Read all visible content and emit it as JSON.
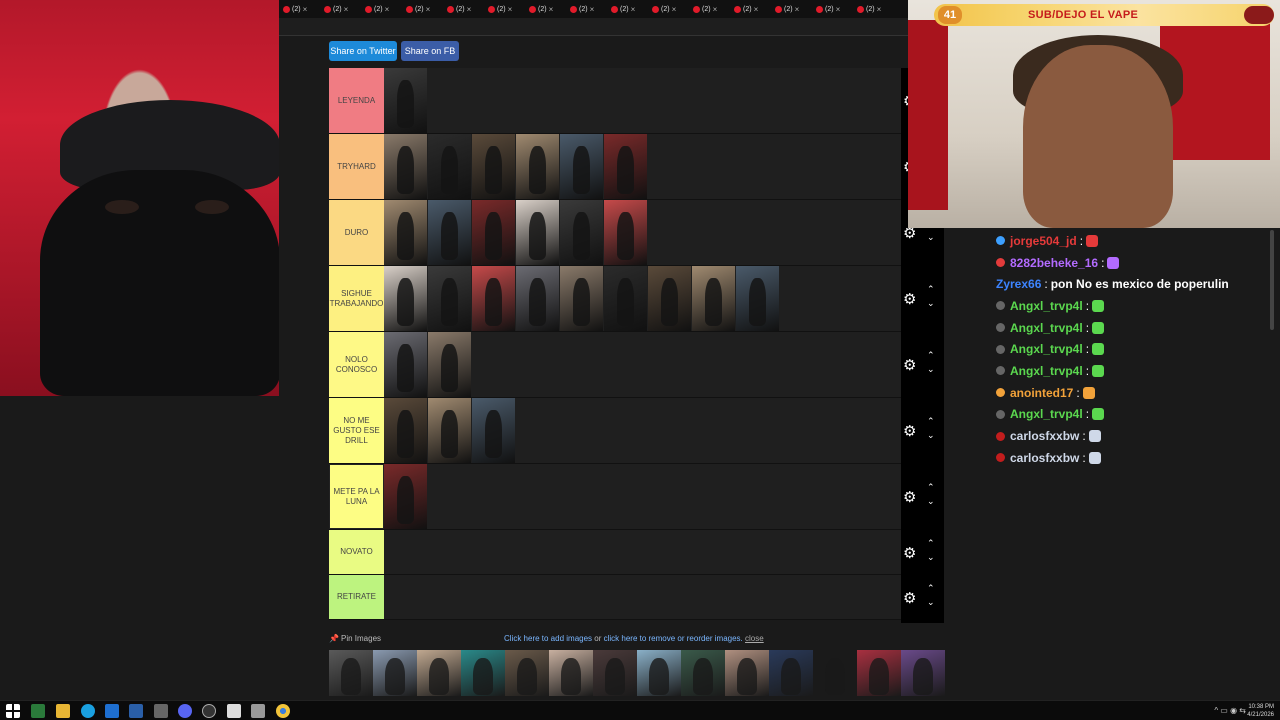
{
  "overlay": {
    "sub_count": "41",
    "banner_text": "SUB/DEJO EL VAPE"
  },
  "tabstrip": {
    "tabs": [
      {
        "count": "(2)",
        "close": "×"
      },
      {
        "count": "(2)",
        "close": "×"
      },
      {
        "count": "(2)",
        "close": "×"
      },
      {
        "count": "(2)",
        "close": "×"
      },
      {
        "count": "(2)",
        "close": "×"
      },
      {
        "count": "(2)",
        "close": "×"
      },
      {
        "count": "(2)",
        "close": "×"
      },
      {
        "count": "(2)",
        "close": "×"
      },
      {
        "count": "(2)",
        "close": "×"
      },
      {
        "count": "(2)",
        "close": "×"
      },
      {
        "count": "(2)",
        "close": "×"
      },
      {
        "count": "(2)",
        "close": "×"
      },
      {
        "count": "(2)",
        "close": "×"
      },
      {
        "count": "(2)",
        "close": "×"
      },
      {
        "count": "(2)",
        "close": "×"
      }
    ]
  },
  "share": {
    "twitter": "Share on Twitter",
    "fb": "Share on FB"
  },
  "tiers": [
    {
      "label": "LEYENDA",
      "color": "#f07c83",
      "images": 1
    },
    {
      "label": "TRYHARD",
      "color": "#f9bf7e",
      "images": 6
    },
    {
      "label": "DURO",
      "color": "#fbd983",
      "images": 6
    },
    {
      "label": "SIGHUE TRABAJANDO",
      "color": "#fdf081",
      "images": 9
    },
    {
      "label": "NOLO CONOSCO",
      "color": "#fef986",
      "images": 2
    },
    {
      "label": "NO ME GUSTO ESE DRILL",
      "color": "#fdfd84",
      "images": 3
    },
    {
      "label": "METE PA LA LUNA",
      "color": "#fdfd84",
      "images": 1
    },
    {
      "label": "NOVATO",
      "color": "#e9fb83",
      "images": 0
    },
    {
      "label": "RETIRATE",
      "color": "#bdf37f",
      "images": 0
    }
  ],
  "controls": {
    "gear": "⚙",
    "up": "⌃",
    "down": "⌄"
  },
  "pin": {
    "label": "Pin Images",
    "add_text": "Click here to add images",
    "or_text": " or ",
    "reorder_text": "click here to remove or reorder images.",
    "close_text": "close"
  },
  "chat": [
    {
      "user": "jorge504_jd",
      "color": "#e53a3a",
      "badge": "#3da0ff"
    },
    {
      "user": "8282beheke_16",
      "color": "#b36bff",
      "badge": "#e33b3b"
    },
    {
      "user": "Zyrex66",
      "color": "#3d84ff",
      "badge": "",
      "text": "pon No es mexico de poperulin"
    },
    {
      "user": "Angxl_trvp4l",
      "color": "#5bd84f",
      "badge": "#666"
    },
    {
      "user": "Angxl_trvp4l",
      "color": "#5bd84f",
      "badge": "#666"
    },
    {
      "user": "Angxl_trvp4l",
      "color": "#5bd84f",
      "badge": "#666"
    },
    {
      "user": "Angxl_trvp4l",
      "color": "#5bd84f",
      "badge": "#666"
    },
    {
      "user": "anointed17",
      "color": "#f2a23a",
      "badge": "#f2a23a"
    },
    {
      "user": "Angxl_trvp4l",
      "color": "#5bd84f",
      "badge": "#666"
    },
    {
      "user": "carlosfxxbw",
      "color": "#cfd8e8",
      "badge": "#c21d1d"
    },
    {
      "user": "carlosfxxbw",
      "color": "#cfd8e8",
      "badge": "#c21d1d"
    }
  ],
  "taskbar": {
    "time": "10:38 PM",
    "date": "4/21/2026",
    "tray": "^ ▭ ◉ ⇆"
  }
}
